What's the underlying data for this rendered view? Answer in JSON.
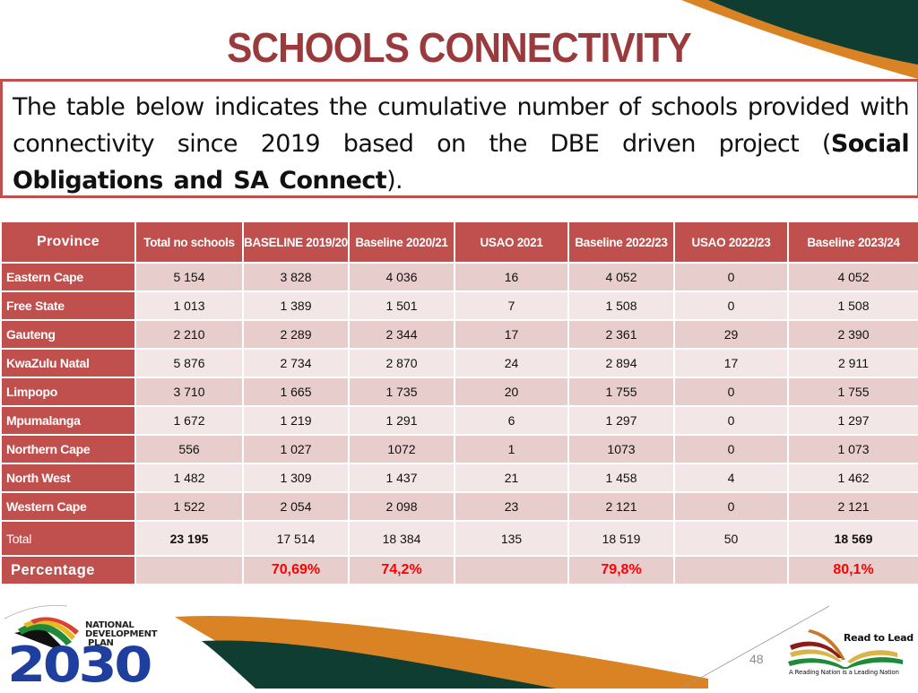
{
  "slide": {
    "title": "SCHOOLS CONNECTIVITY",
    "intro": {
      "text_prefix": "The table below indicates the cumulative number of schools provided with connectivity since 2019 based on the DBE driven project (",
      "bold_part1": "Social Obligations and SA Connect",
      "text_suffix": ")."
    },
    "page_number": "48",
    "colors": {
      "title": "#9b3a3d",
      "table_header": "#c0504d",
      "percentage_text": "#ff0000",
      "deco_green": "#0f3d32",
      "deco_orange": "#d98325",
      "ndp_blue": "#1f3f9e"
    }
  },
  "table": {
    "headers": [
      "Province",
      "Total no schools",
      "BASELINE 2019/20",
      "Baseline 2020/21",
      "USAO 2021",
      "Baseline 2022/23",
      "USAO 2022/23",
      "Baseline 2023/24"
    ],
    "rows": [
      {
        "province": "Eastern Cape",
        "values": [
          "5 154",
          "3 828",
          "4 036",
          "16",
          "4 052",
          "0",
          "4 052"
        ]
      },
      {
        "province": "Free State",
        "values": [
          "1 013",
          "1 389",
          "1 501",
          "7",
          "1 508",
          "0",
          "1 508"
        ]
      },
      {
        "province": "Gauteng",
        "values": [
          "2 210",
          "2 289",
          "2 344",
          "17",
          "2 361",
          "29",
          "2 390"
        ]
      },
      {
        "province": "KwaZulu Natal",
        "values": [
          "5 876",
          "2 734",
          "2 870",
          "24",
          "2 894",
          "17",
          "2 911"
        ]
      },
      {
        "province": "Limpopo",
        "values": [
          "3 710",
          "1 665",
          "1 735",
          "20",
          "1 755",
          "0",
          "1 755"
        ]
      },
      {
        "province": "Mpumalanga",
        "values": [
          "1 672",
          "1 219",
          "1 291",
          "6",
          "1 297",
          "0",
          "1 297"
        ]
      },
      {
        "province": "Northern Cape",
        "values": [
          "556",
          "1 027",
          "1072",
          "1",
          "1073",
          "0",
          "1 073"
        ]
      },
      {
        "province": "North West",
        "values": [
          "1 482",
          "1 309",
          "1 437",
          "21",
          "1 458",
          "4",
          "1 462"
        ]
      },
      {
        "province": "Western Cape",
        "values": [
          "1 522",
          "2 054",
          "2 098",
          "23",
          "2 121",
          "0",
          "2 121"
        ]
      }
    ],
    "total": {
      "label": "Total",
      "values": [
        "23 195",
        "17 514",
        "18 384",
        "135",
        "18 519",
        "50",
        "18 569"
      ]
    },
    "percentage": {
      "label": "Percentage",
      "values": [
        "",
        "70,69%",
        "74,2%",
        "",
        "79,8%",
        "",
        "80,1%"
      ]
    }
  },
  "logos": {
    "ndp": {
      "line1": "NATIONAL",
      "line2": "DEVELOPMENT",
      "line3": "PLAN",
      "year": "2030"
    },
    "read_to_lead": {
      "title": "Read to Lead",
      "tagline": "A Reading Nation is a Leading Nation"
    }
  }
}
